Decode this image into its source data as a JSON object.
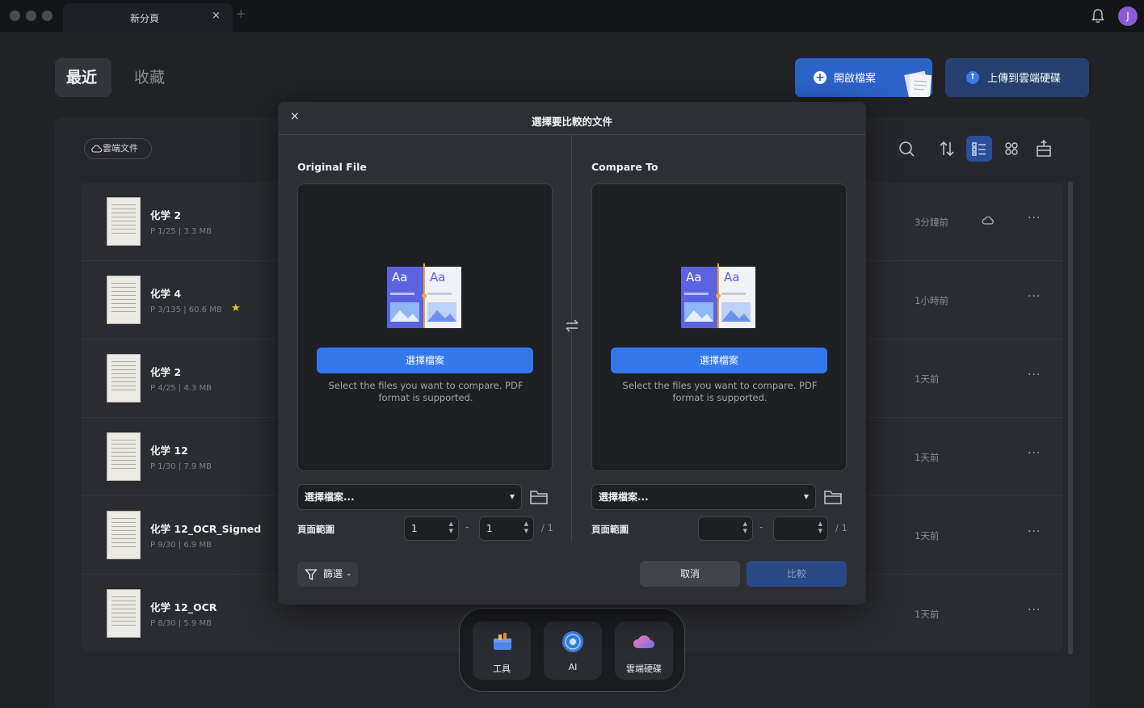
{
  "window": {
    "tab_title": "新分頁",
    "tab_close": "×",
    "tab_add": "+",
    "avatar_initial": "J"
  },
  "nav": {
    "tabs": [
      "最近",
      "收藏"
    ],
    "open_file_label": "開啟檔案",
    "upload_label": "上傳到雲端硬碟",
    "cloud_docs_label": "雲端文件"
  },
  "files": [
    {
      "name": "化学 2",
      "meta": "P 1/25  |  3.3 MB",
      "time": "3分鐘前",
      "starred": false,
      "cloud": true
    },
    {
      "name": "化学 4",
      "meta": "P 3/135  |  60.6 MB",
      "time": "1小時前",
      "starred": true,
      "cloud": false
    },
    {
      "name": "化学 2",
      "meta": "P 4/25  |  4.3 MB",
      "time": "1天前",
      "starred": false,
      "cloud": false
    },
    {
      "name": "化学 12",
      "meta": "P 1/30  |  7.9 MB",
      "time": "1天前",
      "starred": false,
      "cloud": false
    },
    {
      "name": "化学 12_OCR_Signed",
      "meta": "P 9/30  |  6.9 MB",
      "time": "1天前",
      "starred": false,
      "cloud": false
    },
    {
      "name": "化学 12_OCR",
      "meta": "P 8/30  |  5.9 MB",
      "time": "1天前",
      "starred": false,
      "cloud": false
    }
  ],
  "more_label": "···",
  "dock": {
    "items": [
      {
        "label": "工具",
        "icon": "toolbox-icon"
      },
      {
        "label": "AI",
        "icon": "ai-orb-icon"
      },
      {
        "label": "雲端硬碟",
        "icon": "cloud-drive-icon"
      }
    ]
  },
  "modal": {
    "close": "×",
    "title": "選擇要比較的文件",
    "left": {
      "heading": "Original File",
      "choose_label": "選擇檔案",
      "hint": "Select the files you want to compare. PDF format is supported.",
      "select_value": "選擇檔案...",
      "range_label": "頁面範圍",
      "range_from": "1",
      "range_to": "1",
      "total": "/ 1"
    },
    "right": {
      "heading": "Compare To",
      "choose_label": "選擇檔案",
      "hint": "Select the files you want to compare. PDF format is supported.",
      "select_value": "選擇檔案...",
      "range_label": "頁面範圍",
      "range_from": "",
      "range_to": "",
      "total": "/ 1"
    },
    "range_dash": "-",
    "filter_label": "篩選",
    "cancel_label": "取消",
    "compare_label": "比較",
    "illus_text": "Aa"
  },
  "colors": {
    "accent": "#3378ea",
    "star": "#f0c02c"
  }
}
